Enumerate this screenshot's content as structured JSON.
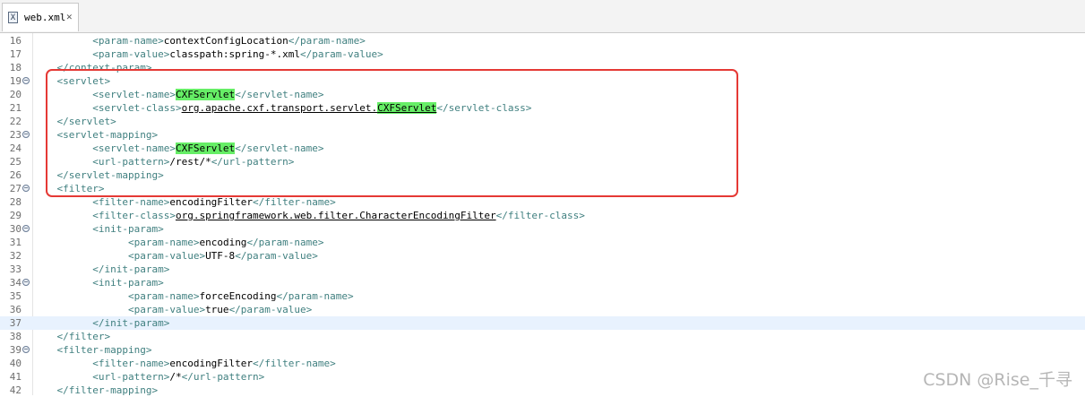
{
  "tab": {
    "title": "web.xml",
    "icon": "xml-file-icon",
    "close": "✕"
  },
  "lines": [
    {
      "n": "16",
      "indent": "          ",
      "parts": [
        {
          "t": "<param-name>",
          "c": "tag"
        },
        {
          "t": "contextConfigLocation",
          "c": "txt"
        },
        {
          "t": "</param-name>",
          "c": "tag"
        }
      ]
    },
    {
      "n": "17",
      "indent": "          ",
      "parts": [
        {
          "t": "<param-value>",
          "c": "tag"
        },
        {
          "t": "classpath:spring-*.xml",
          "c": "txt"
        },
        {
          "t": "</param-value>",
          "c": "tag"
        }
      ]
    },
    {
      "n": "18",
      "indent": "    ",
      "parts": [
        {
          "t": "</context-param>",
          "c": "tag"
        }
      ]
    },
    {
      "n": "19",
      "fold": true,
      "indent": "    ",
      "parts": [
        {
          "t": "<servlet>",
          "c": "tag"
        }
      ]
    },
    {
      "n": "20",
      "indent": "          ",
      "parts": [
        {
          "t": "<servlet-name>",
          "c": "tag"
        },
        {
          "t": "CXFServlet",
          "c": "txt hl"
        },
        {
          "t": "</servlet-name>",
          "c": "tag"
        }
      ]
    },
    {
      "n": "21",
      "indent": "          ",
      "parts": [
        {
          "t": "<servlet-class>",
          "c": "tag"
        },
        {
          "t": "org.apache.cxf.transport.servlet.",
          "c": "txt und"
        },
        {
          "t": "CXFServlet",
          "c": "txt und hl"
        },
        {
          "t": "</servlet-class>",
          "c": "tag"
        }
      ]
    },
    {
      "n": "22",
      "indent": "    ",
      "parts": [
        {
          "t": "</servlet>",
          "c": "tag"
        }
      ]
    },
    {
      "n": "23",
      "fold": true,
      "indent": "    ",
      "parts": [
        {
          "t": "<servlet-mapping>",
          "c": "tag"
        }
      ]
    },
    {
      "n": "24",
      "indent": "          ",
      "parts": [
        {
          "t": "<servlet-name>",
          "c": "tag"
        },
        {
          "t": "CXFServlet",
          "c": "txt hl"
        },
        {
          "t": "</servlet-name>",
          "c": "tag"
        }
      ]
    },
    {
      "n": "25",
      "indent": "          ",
      "parts": [
        {
          "t": "<url-pattern>",
          "c": "tag"
        },
        {
          "t": "/rest/*",
          "c": "txt"
        },
        {
          "t": "</url-pattern>",
          "c": "tag"
        }
      ]
    },
    {
      "n": "26",
      "indent": "    ",
      "parts": [
        {
          "t": "</servlet-mapping>",
          "c": "tag"
        }
      ]
    },
    {
      "n": "27",
      "fold": true,
      "indent": "    ",
      "parts": [
        {
          "t": "<filter>",
          "c": "tag"
        }
      ]
    },
    {
      "n": "28",
      "indent": "          ",
      "parts": [
        {
          "t": "<filter-name>",
          "c": "tag"
        },
        {
          "t": "encodingFilter",
          "c": "txt"
        },
        {
          "t": "</filter-name>",
          "c": "tag"
        }
      ]
    },
    {
      "n": "29",
      "indent": "          ",
      "parts": [
        {
          "t": "<filter-class>",
          "c": "tag"
        },
        {
          "t": "org.springframework.web.filter.CharacterEncodingFilter",
          "c": "txt und"
        },
        {
          "t": "</filter-class>",
          "c": "tag"
        }
      ]
    },
    {
      "n": "30",
      "fold": true,
      "indent": "          ",
      "parts": [
        {
          "t": "<init-param>",
          "c": "tag"
        }
      ]
    },
    {
      "n": "31",
      "indent": "                ",
      "parts": [
        {
          "t": "<param-name>",
          "c": "tag"
        },
        {
          "t": "encoding",
          "c": "txt"
        },
        {
          "t": "</param-name>",
          "c": "tag"
        }
      ]
    },
    {
      "n": "32",
      "indent": "                ",
      "parts": [
        {
          "t": "<param-value>",
          "c": "tag"
        },
        {
          "t": "UTF-8",
          "c": "txt"
        },
        {
          "t": "</param-value>",
          "c": "tag"
        }
      ]
    },
    {
      "n": "33",
      "indent": "          ",
      "parts": [
        {
          "t": "</init-param>",
          "c": "tag"
        }
      ]
    },
    {
      "n": "34",
      "fold": true,
      "indent": "          ",
      "parts": [
        {
          "t": "<init-param>",
          "c": "tag"
        }
      ]
    },
    {
      "n": "35",
      "indent": "                ",
      "parts": [
        {
          "t": "<param-name>",
          "c": "tag"
        },
        {
          "t": "forceEncoding",
          "c": "txt"
        },
        {
          "t": "</param-name>",
          "c": "tag"
        }
      ]
    },
    {
      "n": "36",
      "indent": "                ",
      "parts": [
        {
          "t": "<param-value>",
          "c": "tag"
        },
        {
          "t": "true",
          "c": "txt"
        },
        {
          "t": "</param-value>",
          "c": "tag"
        }
      ]
    },
    {
      "n": "37",
      "current": true,
      "indent": "          ",
      "parts": [
        {
          "t": "</init-param>",
          "c": "tag"
        }
      ]
    },
    {
      "n": "38",
      "indent": "    ",
      "parts": [
        {
          "t": "</filter>",
          "c": "tag"
        }
      ]
    },
    {
      "n": "39",
      "fold": true,
      "indent": "    ",
      "parts": [
        {
          "t": "<filter-mapping>",
          "c": "tag"
        }
      ]
    },
    {
      "n": "40",
      "indent": "          ",
      "parts": [
        {
          "t": "<filter-name>",
          "c": "tag"
        },
        {
          "t": "encodingFilter",
          "c": "txt"
        },
        {
          "t": "</filter-name>",
          "c": "tag"
        }
      ]
    },
    {
      "n": "41",
      "indent": "          ",
      "parts": [
        {
          "t": "<url-pattern>",
          "c": "tag"
        },
        {
          "t": "/*",
          "c": "txt"
        },
        {
          "t": "</url-pattern>",
          "c": "tag"
        }
      ]
    },
    {
      "n": "42",
      "indent": "    ",
      "parts": [
        {
          "t": "</filter-mapping>",
          "c": "tag"
        }
      ]
    }
  ],
  "watermark": "CSDN @Rise_千寻",
  "colors": {
    "tag": "#3f7f7f",
    "highlight": "#66ee66",
    "annotation_box": "#e53935",
    "current_line": "#e8f2fe"
  }
}
